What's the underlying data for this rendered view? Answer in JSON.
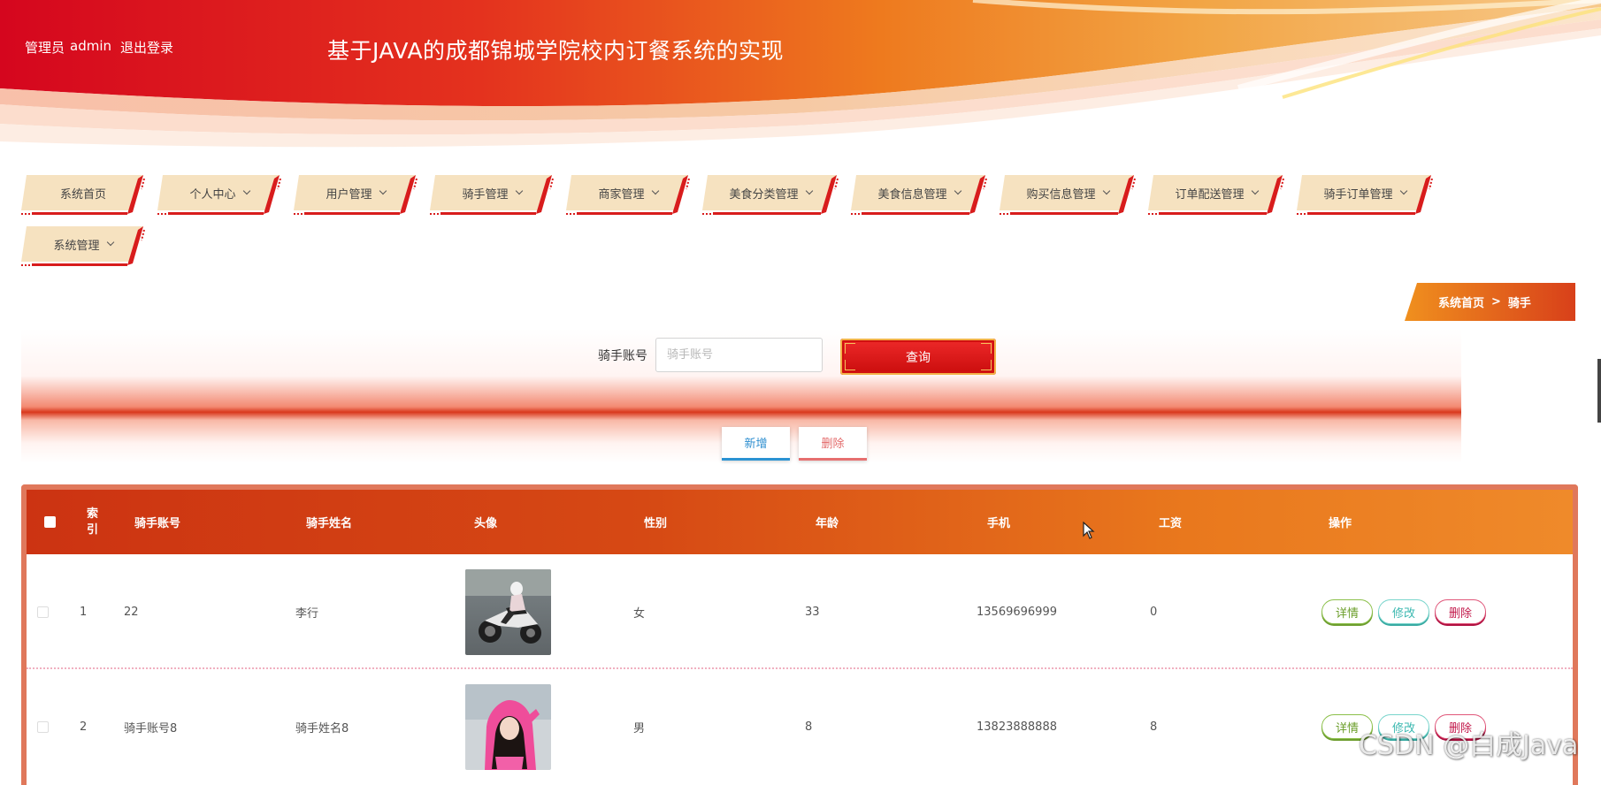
{
  "header": {
    "role": "管理员",
    "username": "admin",
    "logout": "退出登录",
    "title": "基于JAVA的成都锦城学院校内订餐系统的实现"
  },
  "nav": {
    "items": [
      {
        "label": "系统首页",
        "dropdown": false
      },
      {
        "label": "个人中心",
        "dropdown": true
      },
      {
        "label": "用户管理",
        "dropdown": true
      },
      {
        "label": "骑手管理",
        "dropdown": true
      },
      {
        "label": "商家管理",
        "dropdown": true
      },
      {
        "label": "美食分类管理",
        "dropdown": true
      },
      {
        "label": "美食信息管理",
        "dropdown": true
      },
      {
        "label": "购买信息管理",
        "dropdown": true
      },
      {
        "label": "订单配送管理",
        "dropdown": true
      },
      {
        "label": "骑手订单管理",
        "dropdown": true
      },
      {
        "label": "系统管理",
        "dropdown": true
      }
    ]
  },
  "breadcrumb": {
    "home": "系统首页",
    "separator": ">",
    "current": "骑手"
  },
  "search": {
    "label": "骑手账号",
    "placeholder": "骑手账号",
    "value": "",
    "button": "查询"
  },
  "actions": {
    "add": "新增",
    "delete": "删除"
  },
  "table": {
    "columns": {
      "index_line1": "索",
      "index_line2": "引",
      "account": "骑手账号",
      "name": "骑手姓名",
      "avatar": "头像",
      "gender": "性别",
      "age": "年龄",
      "phone": "手机",
      "salary": "工资",
      "ops": "操作"
    },
    "rows": [
      {
        "index": "1",
        "account": "22",
        "name": "李行",
        "gender": "女",
        "age": "33",
        "phone": "13569696999",
        "salary": "0",
        "avatar_icon": "motorcycle-rider-photo"
      },
      {
        "index": "2",
        "account": "骑手账号8",
        "name": "骑手姓名8",
        "gender": "男",
        "age": "8",
        "phone": "13823888888",
        "salary": "8",
        "avatar_icon": "pink-hoodie-girl-photo"
      }
    ],
    "ops": {
      "detail": "详情",
      "edit": "修改",
      "delete": "删除"
    }
  },
  "watermark": "CSDN @白成Java",
  "colors": {
    "brand_red": "#d8101c",
    "brand_orange": "#ef8a2a",
    "nav_tab_bg": "#f6e2c0",
    "detail_green": "#8cc04a",
    "edit_teal": "#79d5cc",
    "delete_crimson": "#e0577a"
  }
}
